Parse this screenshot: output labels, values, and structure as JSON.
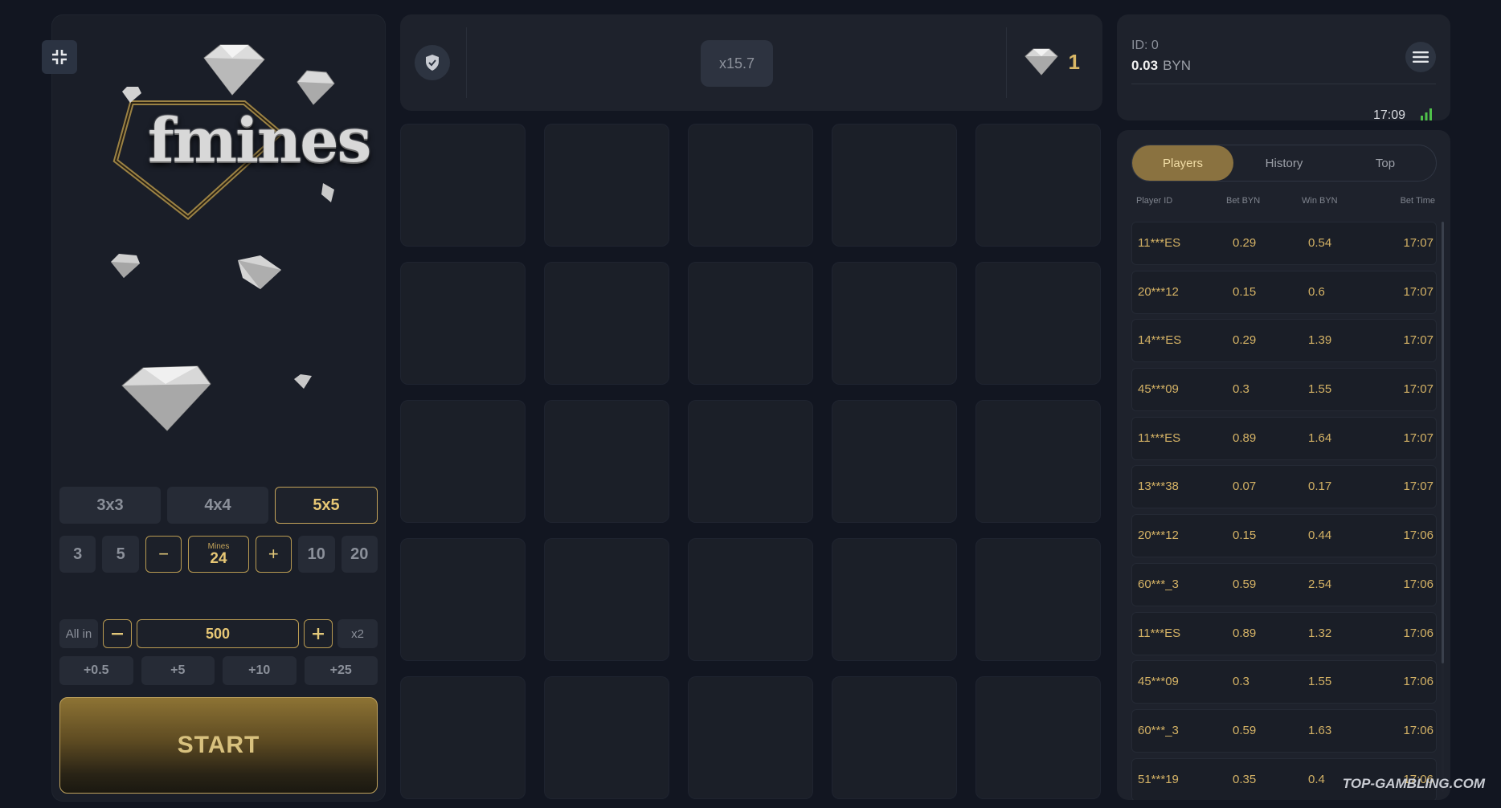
{
  "game": {
    "logo_text": "fmines"
  },
  "settings": {
    "grid_sizes": [
      "3x3",
      "4x4",
      "5x5"
    ],
    "active_grid_size": "5x5",
    "mine_presets_left": [
      "3",
      "5"
    ],
    "mine_presets_right": [
      "10",
      "20"
    ],
    "mines_label": "Mines",
    "mines_value": "24",
    "minus": "−",
    "plus": "+"
  },
  "bet": {
    "all_in_label": "All in",
    "amount": "500",
    "double_label": "x2",
    "quick_adds": [
      "+0.5",
      "+5",
      "+10",
      "+25"
    ],
    "start_label": "START"
  },
  "top_bar": {
    "multiplier": "x15.7",
    "gem_count": "1"
  },
  "account": {
    "id_label": "ID: 0",
    "balance": "0.03",
    "currency": "BYN",
    "time": "17:09"
  },
  "players_panel": {
    "tabs": [
      "Players",
      "History",
      "Top"
    ],
    "active_tab": "Players",
    "headers": [
      "Player ID",
      "Bet  BYN",
      "Win  BYN",
      "Bet Time"
    ],
    "rows": [
      {
        "player": "11***ES",
        "bet": "0.29",
        "win": "0.54",
        "time": "17:07"
      },
      {
        "player": "20***12",
        "bet": "0.15",
        "win": "0.6",
        "time": "17:07"
      },
      {
        "player": "14***ES",
        "bet": "0.29",
        "win": "1.39",
        "time": "17:07"
      },
      {
        "player": "45***09",
        "bet": "0.3",
        "win": "1.55",
        "time": "17:07"
      },
      {
        "player": "11***ES",
        "bet": "0.89",
        "win": "1.64",
        "time": "17:07"
      },
      {
        "player": "13***38",
        "bet": "0.07",
        "win": "0.17",
        "time": "17:07"
      },
      {
        "player": "20***12",
        "bet": "0.15",
        "win": "0.44",
        "time": "17:06"
      },
      {
        "player": "60***_3",
        "bet": "0.59",
        "win": "2.54",
        "time": "17:06"
      },
      {
        "player": "11***ES",
        "bet": "0.89",
        "win": "1.32",
        "time": "17:06"
      },
      {
        "player": "45***09",
        "bet": "0.3",
        "win": "1.55",
        "time": "17:06"
      },
      {
        "player": "60***_3",
        "bet": "0.59",
        "win": "1.63",
        "time": "17:06"
      },
      {
        "player": "51***19",
        "bet": "0.35",
        "win": "0.4",
        "time": "17:06"
      }
    ]
  },
  "watermark": "TOP-GAMBLING.COM",
  "colors": {
    "background": "#121621",
    "panel": "#1e222c",
    "gold_accent": "#d4b265",
    "tab_active": "#8a7240"
  },
  "icons": {
    "fullscreen": "collapse-icon",
    "shield": "shield-icon",
    "gem": "diamond-icon",
    "menu": "hamburger-icon",
    "signal": "signal-icon"
  }
}
